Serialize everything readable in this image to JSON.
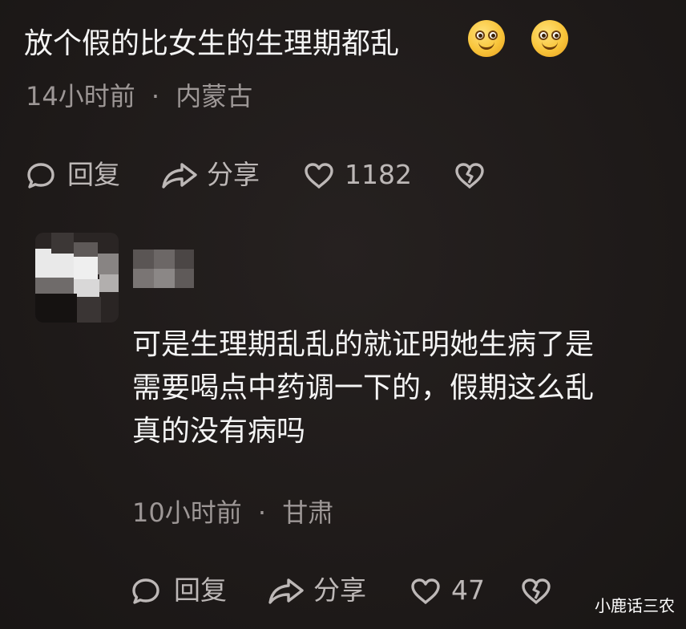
{
  "comments": [
    {
      "text": "放个假的比女生的生理期都乱",
      "emojis": [
        "smile-emoji",
        "smile-emoji"
      ],
      "time": "14小时前",
      "separator": "·",
      "location": "内蒙古",
      "actions": {
        "reply": "回复",
        "share": "分享",
        "likes": "1182"
      }
    },
    {
      "text_lines": [
        "可是生理期乱乱的就证明她生病了是",
        "需要喝点中药调一下的，假期这么乱",
        "真的没有病吗"
      ],
      "time": "10小时前",
      "separator": "·",
      "location": "甘肃",
      "actions": {
        "reply": "回复",
        "share": "分享",
        "likes": "47"
      }
    }
  ],
  "watermark": "小鹿话三农",
  "colors": {
    "background": "#1f1b1a",
    "text": "#f4f4f4",
    "meta": "#9d9796",
    "action": "#bdb8b7",
    "emoji": "#f8c43a"
  }
}
